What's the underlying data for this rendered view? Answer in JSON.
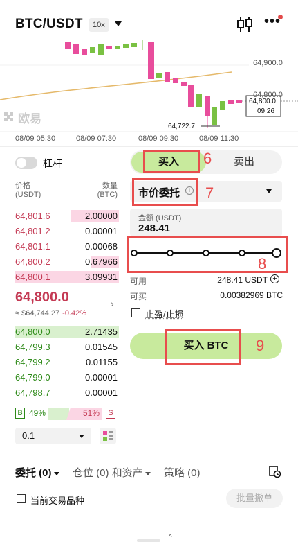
{
  "header": {
    "pair": "BTC/USDT",
    "leverage_badge": "10x"
  },
  "chart": {
    "price_labels": [
      "64,900.0",
      "64,800.0"
    ],
    "current_price": "64,800.0",
    "countdown": "09:26",
    "low_label": "64,722.7",
    "watermark": "欧易",
    "times": [
      "08/09 05:30",
      "08/09 07:30",
      "08/09 09:30",
      "08/09 11:30"
    ]
  },
  "left": {
    "leverage_label": "杠杆",
    "col_price": "价格",
    "col_price_unit": "(USDT)",
    "col_qty": "数量",
    "col_qty_unit": "(BTC)",
    "asks": [
      {
        "price": "64,801.6",
        "qty": "2.00000"
      },
      {
        "price": "64,801.2",
        "qty": "0.00001"
      },
      {
        "price": "64,801.1",
        "qty": "0.00068"
      },
      {
        "price": "64,800.2",
        "qty": "0.67966"
      },
      {
        "price": "64,800.1",
        "qty": "3.09931"
      }
    ],
    "last_price": "64,800.0",
    "approx_price": "≈ $64,744.27",
    "change": "-0.42%",
    "bids": [
      {
        "price": "64,800.0",
        "qty": "2.71435"
      },
      {
        "price": "64,799.3",
        "qty": "0.01545"
      },
      {
        "price": "64,799.2",
        "qty": "0.01155"
      },
      {
        "price": "64,799.0",
        "qty": "0.00001"
      },
      {
        "price": "64,798.7",
        "qty": "0.00001"
      }
    ],
    "buy_tag": "B",
    "buy_pct": "49%",
    "sell_pct": "51%",
    "sell_tag": "S",
    "precision": "0.1"
  },
  "trade": {
    "buy_tab": "买入",
    "sell_tab": "卖出",
    "order_type": "市价委托",
    "amount_label": "金额 (USDT)",
    "amount_value": "248.41",
    "slider_percent": 100,
    "available_label": "可用",
    "available_value": "248.41 USDT",
    "can_buy_label": "可买",
    "can_buy_value": "0.00382969 BTC",
    "tpsl_label": "止盈/止损",
    "buy_button": "买入 BTC"
  },
  "annotations": [
    "6",
    "7",
    "8",
    "9"
  ],
  "tabs": {
    "orders": "委托 (0)",
    "positions": "仓位 (0) 和资产",
    "strategy": "策略 (0)"
  },
  "footer": {
    "current_pair_label": "当前交易品种",
    "batch_cancel": "批量撤单"
  },
  "colors": {
    "accent_green": "#c8ea9d",
    "ask_red": "#c43a54",
    "bid_green": "#2e8a19",
    "annotation_red": "#e84d4d"
  }
}
